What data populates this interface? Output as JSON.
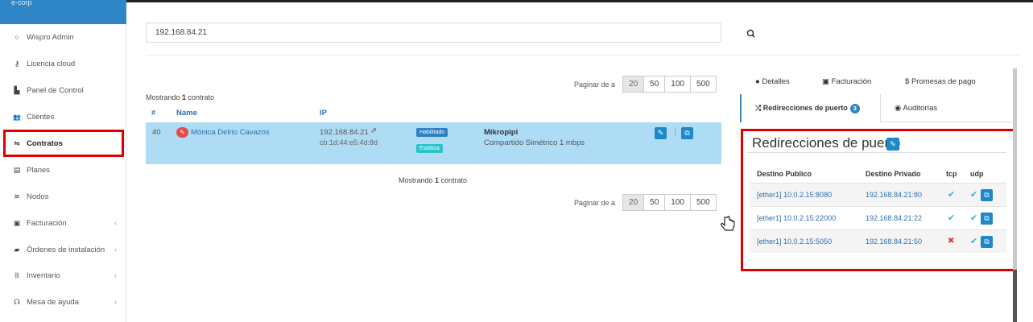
{
  "brand": {
    "label": "e-corp"
  },
  "sidebar": {
    "items": [
      {
        "label": "Wispro Admin",
        "icon": "circle-icon",
        "glyph": "○",
        "chev": ""
      },
      {
        "label": "Licencia cloud",
        "icon": "key-icon",
        "glyph": "⚷",
        "chev": ""
      },
      {
        "label": "Panel de Control",
        "icon": "chart-icon",
        "glyph": "▙",
        "chev": ""
      },
      {
        "label": "Clientes",
        "icon": "users-icon",
        "glyph": "👥",
        "chev": ""
      },
      {
        "label": "Contratos",
        "icon": "handshake-icon",
        "glyph": "⇋",
        "chev": ""
      },
      {
        "label": "Planes",
        "icon": "list-icon",
        "glyph": "▤",
        "chev": ""
      },
      {
        "label": "Nodos",
        "icon": "wifi-icon",
        "glyph": "≋",
        "chev": ""
      },
      {
        "label": "Facturación",
        "icon": "money-icon",
        "glyph": "▣",
        "chev": "‹"
      },
      {
        "label": "Órdenes de instalación",
        "icon": "truck-icon",
        "glyph": "▰",
        "chev": "‹"
      },
      {
        "label": "Inventario",
        "icon": "barcode-icon",
        "glyph": "|||",
        "chev": "‹"
      },
      {
        "label": "Mesa de ayuda",
        "icon": "headset-icon",
        "glyph": "☊",
        "chev": "‹"
      }
    ]
  },
  "search": {
    "value": "192.168.84.21",
    "icon": "search-icon"
  },
  "pagination": {
    "label": "Paginar de a",
    "options": [
      "20",
      "50",
      "100",
      "500"
    ],
    "active": "20"
  },
  "table": {
    "showing_prefix": "Mostrando ",
    "showing_count": "1",
    "showing_suffix": " contrato",
    "headers": {
      "num": "#",
      "name": "Name",
      "ip": "IP"
    },
    "row": {
      "num": "40",
      "name": "Mónica Delrio Cavazos",
      "ip": "192.168.84.21",
      "mac": "cb:1d:44:e5:4d:8d",
      "badge1": "Habilitado",
      "badge2": "Estática",
      "plan": "Mikropipi",
      "plan_desc": "Compartido Simétrico 1 mbps"
    }
  },
  "tabs": {
    "detalles": "Detalles",
    "facturacion": "Facturación",
    "promesas": "Promesas de pago",
    "redirecciones": "Redirecciones de puerto",
    "redirecciones_count": "3",
    "auditorias": "Auditorías"
  },
  "redirects": {
    "title": "Redirecciones de puerto",
    "headers": {
      "pub": "Destino Publico",
      "priv": "Destino Privado",
      "tcp": "tcp",
      "udp": "udp"
    },
    "rows": [
      {
        "pub": "[ether1] 10.0.2.15:8080",
        "priv": "192.168.84.21:80",
        "tcp": "✔",
        "udp": "✔"
      },
      {
        "pub": "[ether1] 10.0.2.15:22000",
        "priv": "192.168.84.21:22",
        "tcp": "✔",
        "udp": "✔"
      },
      {
        "pub": "[ether1] 10.0.2.15:5050",
        "priv": "192.168.84.21:50",
        "tcp": "✖",
        "udp": "✔"
      }
    ]
  },
  "colors": {
    "brand": "#2e86c7",
    "accent": "#1f88c9",
    "highlight": "#e00000",
    "row": "#aedcf5"
  }
}
